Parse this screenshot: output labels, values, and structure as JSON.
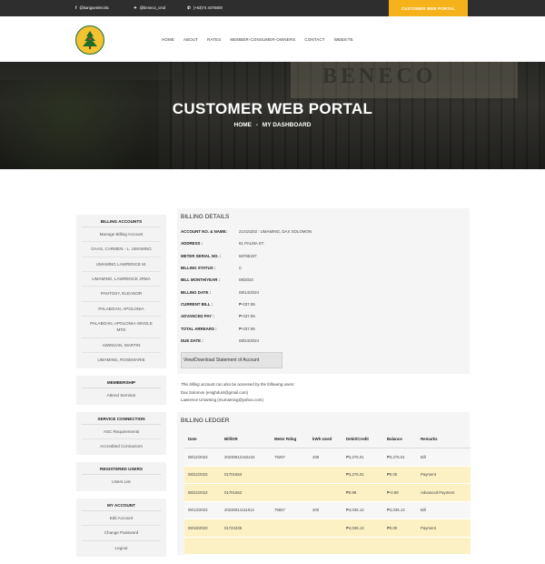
{
  "topbar": {
    "facebook_icon": "f",
    "facebook": "@banguetelectric",
    "twitter_icon": "✦",
    "twitter": "@beneco_cmd",
    "phone_icon": "✆",
    "phone": "(+63)74 4478400",
    "cta": "CUSTOMER WEB PORTAL"
  },
  "nav": {
    "items": [
      "HOME",
      "ABOUT",
      "RATES",
      "MEMBER-CONSUMER-OWNERS",
      "CONTACT",
      "WEBSITE"
    ]
  },
  "hero": {
    "sign": "BENECO",
    "title": "CUSTOMER WEB PORTAL",
    "crumb_home": "HOME",
    "crumb_sep": "-",
    "crumb_current": "MY DASHBOARD"
  },
  "sidebar": {
    "billing_accounts": {
      "heading": "BILLING ACCOUNTS",
      "items": [
        "Manage Billing Account",
        "GAAS, CARMEN - L. UMAMING",
        "UMAMING LAWRENCE M.",
        "UMAMING, LAWRENCE JRMA",
        "PANTOSY, ELEANOR",
        "PALABOAN, APOLONIA",
        "PALABOAN, APOLONIA-SINGLE MTD",
        "AWINGAN, MARTIN",
        "UMAMING, ROSEMARIE"
      ]
    },
    "membership": {
      "heading": "MEMBERSHIP",
      "items": [
        "Attend Seminar"
      ]
    },
    "service_connection": {
      "heading": "SERVICE CONNECTION",
      "items": [
        "ASC Requirements",
        "Accredited Contractors"
      ]
    },
    "registered_users": {
      "heading": "REGISTERED USERS",
      "items": [
        "Users List"
      ]
    },
    "my_account": {
      "heading": "MY ACCOUNT",
      "items": [
        "Edit Account",
        "Change Password",
        "Logout"
      ]
    }
  },
  "billing_details": {
    "heading": "BILLING DETAILS",
    "rows": [
      {
        "label": "ACCOUNT NO. & NAME:",
        "value": "21S15202 : UMAMING, DAX SOLOMON"
      },
      {
        "label": "ADDRESS :",
        "value": "61 PALMA ST."
      },
      {
        "label": "METER SERIAL NO. :",
        "value": "68785337"
      },
      {
        "label": "BILLING STATUS :",
        "value": "C"
      },
      {
        "label": "BILL MONTH/YEAR :",
        "value": "08/2024"
      },
      {
        "label": "BILLING DATE :",
        "value": "08/14/2024"
      },
      {
        "label": "CURRENT BILL :",
        "value": "₱-037.95"
      },
      {
        "label": "ADVANCED PAY :",
        "value": "₱-037.95"
      },
      {
        "label": "TOTAL ARREARS :",
        "value": "₱-037.95"
      },
      {
        "label": "DUE DATE :",
        "value": "08/24/2024"
      }
    ],
    "button": "View/Download Statement of Account",
    "note_intro": "This billing account can also be accessed by the following users:",
    "users": [
      "Dax Solomon (enighdust@gmail.com)",
      "Lawrence Umaming (mumaming@yahoo.com)"
    ]
  },
  "ledger": {
    "heading": "BILLING LEDGER",
    "columns": [
      "Date",
      "Bill/OR",
      "Meter Rdng",
      "kWh Used",
      "Debit/Credit",
      "Balance",
      "Remarks"
    ],
    "rows": [
      {
        "type": "bill",
        "cells": [
          "08/12/2023",
          "20230812162242",
          "79257",
          "339",
          "₱3,275.01",
          "₱3,275.01",
          "Bill"
        ]
      },
      {
        "type": "pay",
        "cells": [
          "08/22/2023",
          "01701653",
          "",
          "",
          "₱3,275.01",
          "₱0.00",
          "Payment"
        ]
      },
      {
        "type": "pay",
        "cells": [
          "08/22/2023",
          "01701653",
          "",
          "",
          "₱0.99",
          "₱-0.99",
          "Advanced Payment"
        ]
      },
      {
        "type": "bill",
        "cells": [
          "09/13/2023",
          "20230914111914",
          "79657",
          "400",
          "₱4,036.12",
          "₱4,035.13",
          "Bill"
        ]
      },
      {
        "type": "pay",
        "cells": [
          "09/18/2023",
          "01723435",
          "",
          "",
          "₱4,035.13",
          "₱0.00",
          "Payment"
        ]
      },
      {
        "type": "pay",
        "cells": [
          "",
          "",
          "",
          "",
          "",
          "",
          ""
        ]
      }
    ]
  }
}
